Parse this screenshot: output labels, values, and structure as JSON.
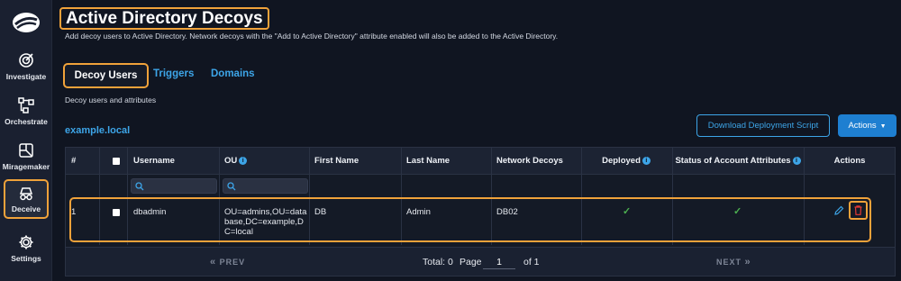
{
  "sidebar": {
    "items": [
      {
        "label": "Investigate",
        "icon": "investigate-icon"
      },
      {
        "label": "Orchestrate",
        "icon": "orchestrate-icon"
      },
      {
        "label": "Miragemaker",
        "icon": "miragemaker-icon"
      },
      {
        "label": "Deceive",
        "icon": "deceive-icon",
        "active": true
      },
      {
        "label": "Settings",
        "icon": "gear-icon"
      }
    ]
  },
  "page": {
    "title": "Active Directory Decoys",
    "subtitle": "Add decoy users to Active Directory. Network decoys with the \"Add to Active Directory\" attribute enabled will also be added to the Active Directory."
  },
  "tabs": [
    {
      "label": "Decoy Users",
      "active": true
    },
    {
      "label": "Triggers"
    },
    {
      "label": "Domains"
    }
  ],
  "section_label": "Decoy users and attributes",
  "domain": "example.local",
  "toolbar": {
    "download_label": "Download Deployment Script",
    "actions_label": "Actions"
  },
  "table": {
    "columns": [
      "#",
      "",
      "Username",
      "OU",
      "First Name",
      "Last Name",
      "Network Decoys",
      "Deployed",
      "Status of Account Attributes",
      "Actions"
    ],
    "rows": [
      {
        "index": "1",
        "username": "dbadmin",
        "ou_lines": [
          "OU=admins,OU=data",
          "base,DC=example,D",
          "C=local"
        ],
        "first_name": "DB",
        "last_name": "Admin",
        "network_decoys": "DB02",
        "deployed": "check-icon",
        "status": "check-icon"
      }
    ],
    "filters": {
      "username": "",
      "ou": ""
    }
  },
  "pagination": {
    "prev": "PREV",
    "next": "NEXT",
    "total_label": "Total: 0",
    "page_label": "Page",
    "page_value": "1",
    "of_label": "of 1"
  },
  "colors": {
    "accent": "#3da5e8",
    "highlight": "#f0a23a",
    "success": "#4caf50",
    "danger": "#e53935"
  }
}
